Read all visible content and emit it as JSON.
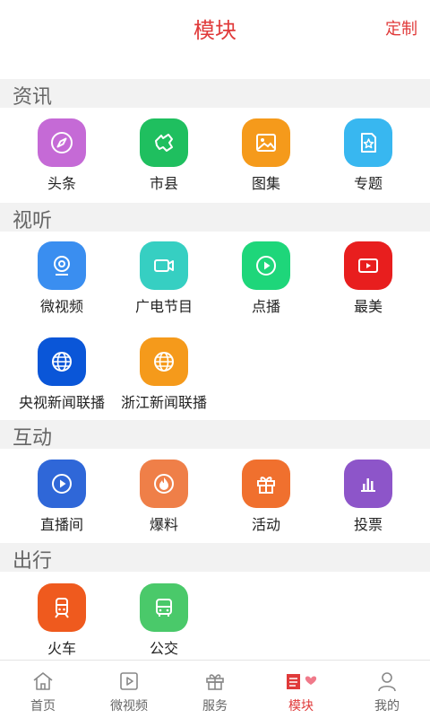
{
  "header": {
    "title": "模块",
    "custom": "定制"
  },
  "sections": [
    {
      "title": "资讯",
      "items": [
        {
          "label": "头条",
          "icon": "compass-icon",
          "color": "#c56ad6"
        },
        {
          "label": "市县",
          "icon": "map-region-icon",
          "color": "#1fbf5f"
        },
        {
          "label": "图集",
          "icon": "image-icon",
          "color": "#f59a1b"
        },
        {
          "label": "专题",
          "icon": "star-doc-icon",
          "color": "#38b7f0"
        }
      ]
    },
    {
      "title": "视听",
      "items": [
        {
          "label": "微视频",
          "icon": "webcam-icon",
          "color": "#3a8ef0"
        },
        {
          "label": "广电节目",
          "icon": "video-camera-icon",
          "color": "#36cfc2"
        },
        {
          "label": "点播",
          "icon": "play-circle-icon",
          "color": "#1ed67a"
        },
        {
          "label": "最美",
          "icon": "play-rect-icon",
          "color": "#e81e1e"
        },
        {
          "label": "央视新闻联播",
          "icon": "globe-icon",
          "color": "#0a56d8"
        },
        {
          "label": "浙江新闻联播",
          "icon": "globe-icon",
          "color": "#f59a1b"
        }
      ]
    },
    {
      "title": "互动",
      "items": [
        {
          "label": "直播间",
          "icon": "play-circle-icon",
          "color": "#2f67d8"
        },
        {
          "label": "爆料",
          "icon": "fire-icon",
          "color": "#ef7f48"
        },
        {
          "label": "活动",
          "icon": "gift-icon",
          "color": "#f0702e"
        },
        {
          "label": "投票",
          "icon": "bar-chart-icon",
          "color": "#8d55c9"
        }
      ]
    },
    {
      "title": "出行",
      "items": [
        {
          "label": "火车",
          "icon": "train-icon",
          "color": "#ef5a1e"
        },
        {
          "label": "公交",
          "icon": "bus-icon",
          "color": "#4ac96a"
        }
      ]
    }
  ],
  "tabbar": {
    "tabs": [
      {
        "label": "首页",
        "icon": "home-icon"
      },
      {
        "label": "微视频",
        "icon": "video-icon"
      },
      {
        "label": "服务",
        "icon": "gift-icon"
      },
      {
        "label": "模块",
        "icon": "modules-icon",
        "active": true
      },
      {
        "label": "我的",
        "icon": "user-icon"
      }
    ]
  },
  "colors": {
    "accent": "#e03a3a",
    "section_bg": "#f2f2f2"
  }
}
